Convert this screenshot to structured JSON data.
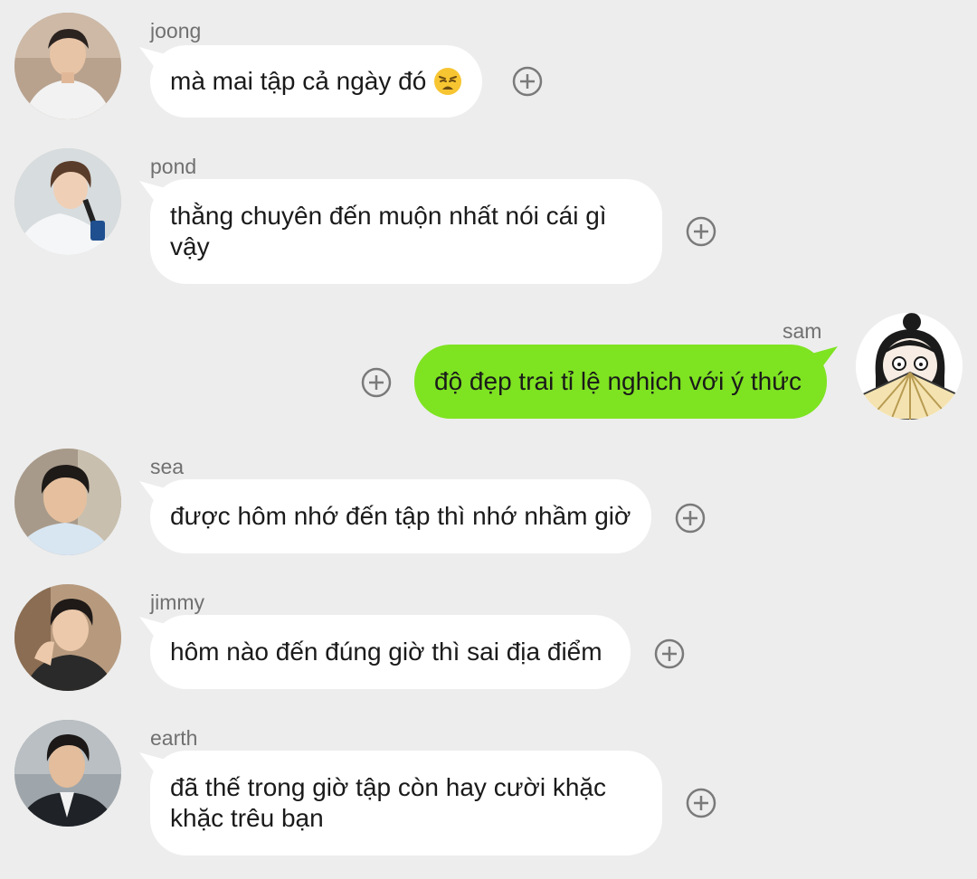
{
  "chat": {
    "messages": [
      {
        "sender": "joong",
        "text": "mà mai tập cả ngày đó",
        "emoji": "weary-face-emoji",
        "direction": "incoming",
        "avatar_icon": "joong-avatar"
      },
      {
        "sender": "pond",
        "text": "thằng chuyên đến muộn nhất nói cái gì vậy",
        "direction": "incoming",
        "avatar_icon": "pond-avatar"
      },
      {
        "sender": "sam",
        "text": "độ đẹp trai tỉ lệ nghịch với ý thức",
        "direction": "outgoing",
        "avatar_icon": "cartoon-girl-fan-avatar"
      },
      {
        "sender": "sea",
        "text": "được hôm nhớ đến tập thì nhớ nhầm giờ",
        "direction": "incoming",
        "avatar_icon": "sea-avatar"
      },
      {
        "sender": "jimmy",
        "text": "hôm nào đến đúng giờ thì sai địa điểm",
        "direction": "incoming",
        "avatar_icon": "jimmy-avatar"
      },
      {
        "sender": "earth",
        "text": "đã thế trong giờ tập còn hay cười khặc khặc trêu bạn",
        "direction": "incoming",
        "avatar_icon": "earth-avatar"
      }
    ],
    "react_icon": "add-reaction-icon",
    "colors": {
      "background": "#ededed",
      "incoming_bubble": "#ffffff",
      "outgoing_bubble": "#7ee321",
      "sender_name": "#707070"
    }
  }
}
